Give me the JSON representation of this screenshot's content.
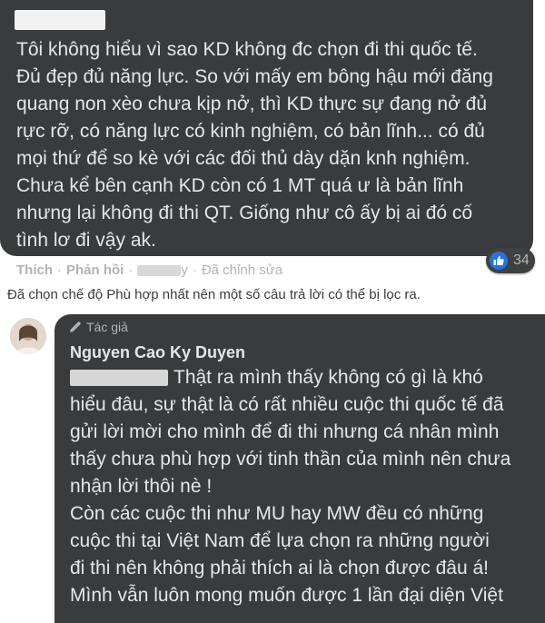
{
  "comment1": {
    "body_lines": [
      "Tôi không hiểu vì sao KD không đc chọn đi thi quốc tế.",
      "Đủ đẹp đủ năng lực. So với mấy em bông hậu mới đăng",
      "quang non xèo chưa kịp nở, thì KD thực sự đang nở đủ",
      "rực rỡ, có năng lực có kinh nghiệm, có bản lĩnh... có đủ",
      "mọi thứ để so kè với các đối thủ dày dặn knh nghiệm.",
      "Chưa kể bên cạnh KD còn có 1 MT quá ư là bản lĩnh",
      "nhưng lại không đi thi QT. Giống như cô ấy bị ai đó cố",
      "tình lơ đi vậy ak."
    ],
    "reaction_count": "34",
    "actions": {
      "like": "Thích",
      "reply": "Phản hồi",
      "time_suffix": "y",
      "edited": "Đã chỉnh sửa"
    }
  },
  "filter_note": "Đã chọn chế độ Phù hợp nhất nên một số câu trả lời có thể bị lọc ra.",
  "reply": {
    "badge": "Tác giả",
    "author_name": "Nguyen Cao Ky Duyen",
    "body_lines": [
      "Thật ra mình thấy không có gì là khó",
      "hiểu đâu, sự thật là có rất nhiều cuộc thi quốc tế đã",
      "gửi lời mời cho mình để đi thi nhưng cá nhân mình",
      "thấy chưa phù hợp với tinh thần của mình nên chưa",
      "nhận lời thôi nè !",
      "Còn các cuộc thi như MU hay MW đều có những",
      "cuộc thi tại Việt Nam để lựa chọn ra những người",
      "đi thi nên không phải thích ai là chọn được đâu á!",
      "Mình vẫn luôn mong muốn được 1 lần đại diện Việt"
    ]
  },
  "icons": {
    "like": "like-icon",
    "pencil": "pencil-icon",
    "avatar": "avatar"
  },
  "colors": {
    "bubble": "#3a3b3c",
    "text": "#e4e6eb",
    "meta": "#b0b3b8",
    "like_blue": "#2374e1"
  }
}
